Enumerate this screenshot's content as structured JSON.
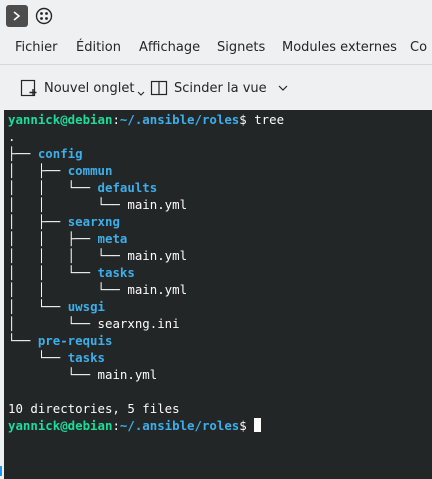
{
  "titlebar": {
    "terminal_icon": "terminal-icon",
    "menu_icon": "app-menu-icon"
  },
  "menubar": [
    "Fichier",
    "Édition",
    "Affichage",
    "Signets",
    "Modules externes",
    "Co"
  ],
  "toolbar": {
    "new_tab_label": "Nouvel onglet",
    "split_view_label": "Scinder la vue"
  },
  "terminal": {
    "prompt_user_host": "yannick@debian",
    "prompt_path": "~/.ansible/roles",
    "prompt_suffix": "$ ",
    "command": "tree",
    "tree": [
      {
        "prefix": ".",
        "name": "",
        "type": "root"
      },
      {
        "prefix": "├── ",
        "name": "config",
        "type": "dir"
      },
      {
        "prefix": "│   ├── ",
        "name": "commun",
        "type": "dir"
      },
      {
        "prefix": "│   │   └── ",
        "name": "defaults",
        "type": "dir"
      },
      {
        "prefix": "│   │       └── ",
        "name": "main.yml",
        "type": "file"
      },
      {
        "prefix": "│   ├── ",
        "name": "searxng",
        "type": "dir"
      },
      {
        "prefix": "│   │   ├── ",
        "name": "meta",
        "type": "dir"
      },
      {
        "prefix": "│   │   │   └── ",
        "name": "main.yml",
        "type": "file"
      },
      {
        "prefix": "│   │   └── ",
        "name": "tasks",
        "type": "dir"
      },
      {
        "prefix": "│   │       └── ",
        "name": "main.yml",
        "type": "file"
      },
      {
        "prefix": "│   └── ",
        "name": "uwsgi",
        "type": "dir"
      },
      {
        "prefix": "│       └── ",
        "name": "searxng.ini",
        "type": "file"
      },
      {
        "prefix": "└── ",
        "name": "pre-requis",
        "type": "dir"
      },
      {
        "prefix": "    └── ",
        "name": "tasks",
        "type": "dir"
      },
      {
        "prefix": "        └── ",
        "name": "main.yml",
        "type": "file"
      }
    ],
    "summary": "10 directories, 5 files"
  }
}
